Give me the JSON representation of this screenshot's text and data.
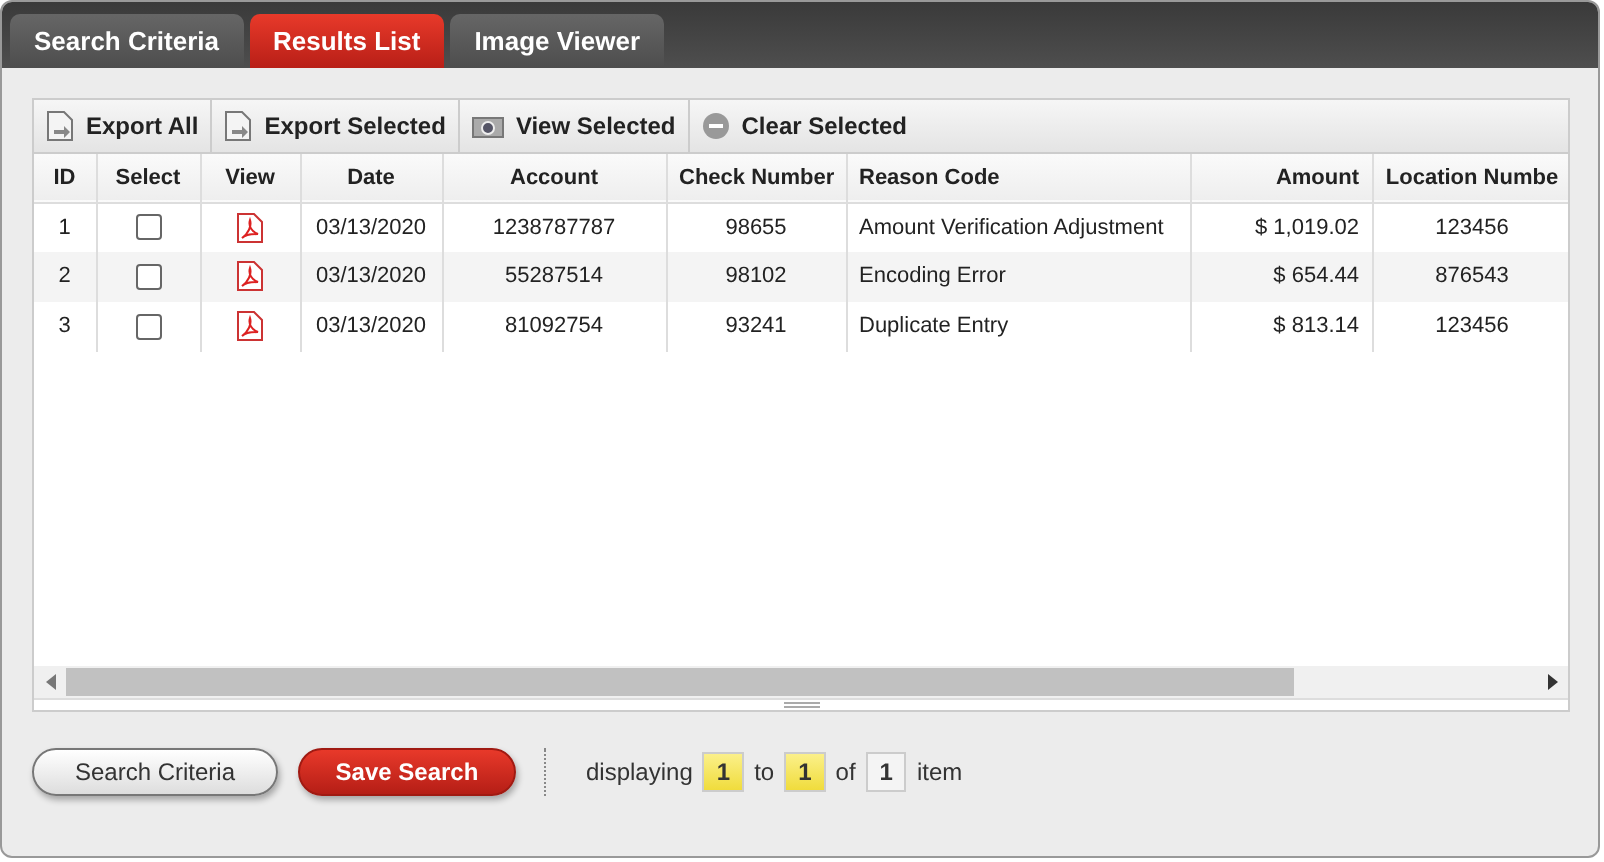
{
  "tabs": [
    {
      "label": "Search Criteria",
      "selected": false
    },
    {
      "label": "Results List",
      "selected": true
    },
    {
      "label": "Image Viewer",
      "selected": false
    }
  ],
  "toolbar": [
    {
      "label": "Export All",
      "kind": "export"
    },
    {
      "label": "Export Selected",
      "kind": "export"
    },
    {
      "label": "View Selected",
      "kind": "camera"
    },
    {
      "label": "Clear Selected",
      "kind": "clear"
    }
  ],
  "table": {
    "columns": [
      "ID",
      "Select",
      "View",
      "Date",
      "Account",
      "Check Number",
      "Reason Code",
      "Amount",
      "Location Numbe"
    ],
    "rows": [
      {
        "id": "1",
        "checked": false,
        "date": "03/13/2020",
        "account": "1238787787",
        "check_number": "98655",
        "reason_code": "Amount Verification Adjustment",
        "amount": "$ 1,019.02",
        "location_number": "123456"
      },
      {
        "id": "2",
        "checked": false,
        "date": "03/13/2020",
        "account": "55287514",
        "check_number": "98102",
        "reason_code": "Encoding Error",
        "amount": "$ 654.44",
        "location_number": "876543"
      },
      {
        "id": "3",
        "checked": false,
        "date": "03/13/2020",
        "account": "81092754",
        "check_number": "93241",
        "reason_code": "Duplicate Entry",
        "amount": "$ 813.14",
        "location_number": "123456"
      }
    ]
  },
  "buttons": [
    {
      "label": "Search Criteria",
      "kind": "secondary"
    },
    {
      "label": "Save Search",
      "kind": "primary"
    }
  ],
  "pager": {
    "prefix": "displaying",
    "from": "1",
    "to_word": "to",
    "to": "1",
    "of_word": "of",
    "total": "1",
    "suffix": "item"
  }
}
